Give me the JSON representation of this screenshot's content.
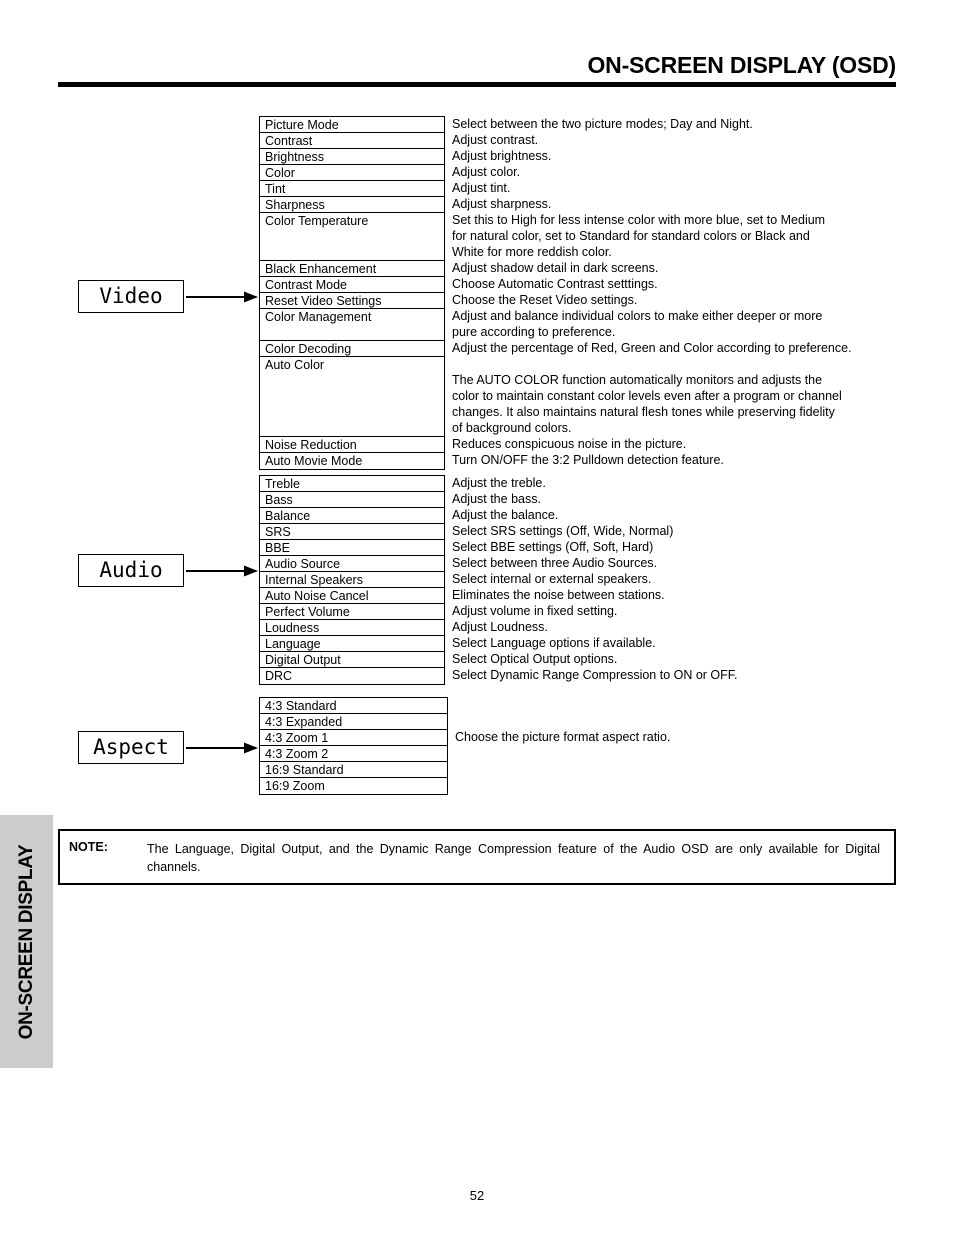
{
  "header": {
    "title": "ON-SCREEN DISPLAY (OSD)"
  },
  "side_tab": {
    "label": "ON-SCREEN DISPLAY"
  },
  "sections": [
    {
      "menu_label": "Video",
      "options": [
        {
          "name": "Picture Mode",
          "lines": 1,
          "desc": [
            "Select between the two picture modes; Day and Night."
          ]
        },
        {
          "name": "Contrast",
          "lines": 1,
          "desc": [
            "Adjust contrast."
          ]
        },
        {
          "name": "Brightness",
          "lines": 1,
          "desc": [
            "Adjust brightness."
          ]
        },
        {
          "name": "Color",
          "lines": 1,
          "desc": [
            "Adjust color."
          ]
        },
        {
          "name": "Tint",
          "lines": 1,
          "desc": [
            "Adjust tint."
          ]
        },
        {
          "name": "Sharpness",
          "lines": 1,
          "desc": [
            "Adjust sharpness."
          ]
        },
        {
          "name": "Color Temperature",
          "lines": 3,
          "desc": [
            "Set this to High for less intense color with more blue, set to Medium",
            "for natural color, set to Standard for standard colors or Black and",
            "White for more reddish color."
          ]
        },
        {
          "name": "Black Enhancement",
          "lines": 1,
          "desc": [
            "Adjust shadow detail in dark screens."
          ]
        },
        {
          "name": "Contrast Mode",
          "lines": 1,
          "desc": [
            "Choose Automatic Contrast setttings."
          ]
        },
        {
          "name": "Reset Video Settings",
          "lines": 1,
          "desc": [
            "Choose the Reset Video settings."
          ]
        },
        {
          "name": "Color Management",
          "lines": 2,
          "desc": [
            "Adjust and balance individual colors to make either deeper or more",
            "pure according to preference."
          ]
        },
        {
          "name": "Color Decoding",
          "lines": 1,
          "desc": [
            "Adjust the percentage of Red, Green and Color according to preference."
          ]
        },
        {
          "name": "Auto Color",
          "lines": 5,
          "desc": [
            "",
            "The AUTO COLOR function automatically monitors and adjusts the",
            "color to maintain constant color levels even after a program or channel",
            "changes. It also maintains natural flesh tones while preserving fidelity",
            "of background colors."
          ]
        },
        {
          "name": "Noise Reduction",
          "lines": 1,
          "desc": [
            "Reduces conspicuous noise in the picture."
          ]
        },
        {
          "name": "Auto Movie Mode",
          "lines": 1,
          "desc": [
            "Turn ON/OFF the 3:2 Pulldown detection feature."
          ]
        }
      ]
    },
    {
      "menu_label": "Audio",
      "options": [
        {
          "name": "Treble",
          "lines": 1,
          "desc": [
            "Adjust the treble."
          ]
        },
        {
          "name": "Bass",
          "lines": 1,
          "desc": [
            "Adjust the bass."
          ]
        },
        {
          "name": "Balance",
          "lines": 1,
          "desc": [
            "Adjust the balance."
          ]
        },
        {
          "name": "SRS",
          "lines": 1,
          "desc": [
            "Select SRS settings (Off, Wide, Normal)"
          ]
        },
        {
          "name": "BBE",
          "lines": 1,
          "desc": [
            "Select BBE settings (Off, Soft, Hard)"
          ]
        },
        {
          "name": "Audio Source",
          "lines": 1,
          "desc": [
            "Select between three Audio Sources."
          ]
        },
        {
          "name": "Internal Speakers",
          "lines": 1,
          "desc": [
            "Select internal or external speakers."
          ]
        },
        {
          "name": "Auto Noise Cancel",
          "lines": 1,
          "desc": [
            "Eliminates the noise between stations."
          ]
        },
        {
          "name": "Perfect Volume",
          "lines": 1,
          "desc": [
            "Adjust volume in fixed setting."
          ]
        },
        {
          "name": "Loudness",
          "lines": 1,
          "desc": [
            "Adjust Loudness."
          ]
        },
        {
          "name": "Language",
          "lines": 1,
          "desc": [
            "Select Language options if available."
          ]
        },
        {
          "name": "Digital Output",
          "lines": 1,
          "desc": [
            "Select Optical Output options."
          ]
        },
        {
          "name": "DRC",
          "lines": 1,
          "desc": [
            "Select Dynamic Range Compression to ON or OFF."
          ]
        }
      ]
    },
    {
      "menu_label": "Aspect",
      "options": [
        {
          "name": "4:3 Standard",
          "lines": 1,
          "desc": [
            ""
          ]
        },
        {
          "name": "4:3 Expanded",
          "lines": 1,
          "desc": [
            ""
          ]
        },
        {
          "name": "4:3 Zoom 1",
          "lines": 1,
          "desc": [
            "Choose the picture format aspect ratio."
          ]
        },
        {
          "name": "4:3 Zoom 2",
          "lines": 1,
          "desc": [
            ""
          ]
        },
        {
          "name": "16:9 Standard",
          "lines": 1,
          "desc": [
            ""
          ]
        },
        {
          "name": "16:9 Zoom",
          "lines": 1,
          "desc": [
            ""
          ]
        }
      ]
    }
  ],
  "note": {
    "label": "NOTE:",
    "text": "The Language, Digital Output, and the Dynamic Range Compression feature of the Audio OSD are only available for Digital channels."
  },
  "page_number": "52"
}
